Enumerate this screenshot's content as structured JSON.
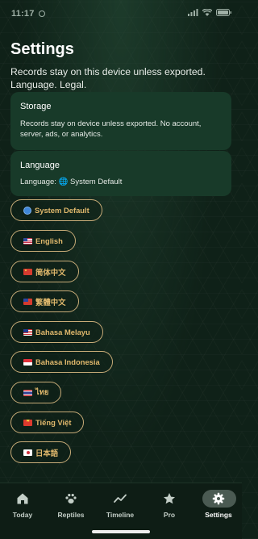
{
  "status_bar": {
    "time": "11:17"
  },
  "header": {
    "title": "Settings",
    "subtitle": "Records stay on this device unless exported. Language. Legal."
  },
  "storage_card": {
    "title": "Storage",
    "body": "Records stay on device unless exported. No account, server, ads, or analytics."
  },
  "language_card": {
    "title": "Language",
    "current": "Language: 🌐 System Default"
  },
  "languages": [
    {
      "flag": "globe-icon",
      "label": "System Default"
    },
    {
      "flag": "us-flag-icon",
      "label": "English"
    },
    {
      "flag": "cn-flag-icon",
      "label": "简体中文"
    },
    {
      "flag": "tw-flag-icon",
      "label": "繁體中文"
    },
    {
      "flag": "my-flag-icon",
      "label": "Bahasa Melayu"
    },
    {
      "flag": "id-flag-icon",
      "label": "Bahasa Indonesia"
    },
    {
      "flag": "th-flag-icon",
      "label": "ไทย"
    },
    {
      "flag": "vn-flag-icon",
      "label": "Tiếng Việt"
    },
    {
      "flag": "jp-flag-icon",
      "label": "日本語"
    }
  ],
  "tabs": [
    {
      "label": "Today",
      "icon": "home-icon"
    },
    {
      "label": "Reptiles",
      "icon": "paw-icon"
    },
    {
      "label": "Timeline",
      "icon": "trend-line-icon"
    },
    {
      "label": "Pro",
      "icon": "star-icon"
    },
    {
      "label": "Settings",
      "icon": "gear-icon",
      "active": true
    }
  ],
  "colors": {
    "background": "#0f2118",
    "card": "#183a29",
    "chip_border": "#c8ac78",
    "chip_text": "#e0b86c",
    "tab_bar": "#0e1d15",
    "active_pill": "#4a5a52"
  }
}
